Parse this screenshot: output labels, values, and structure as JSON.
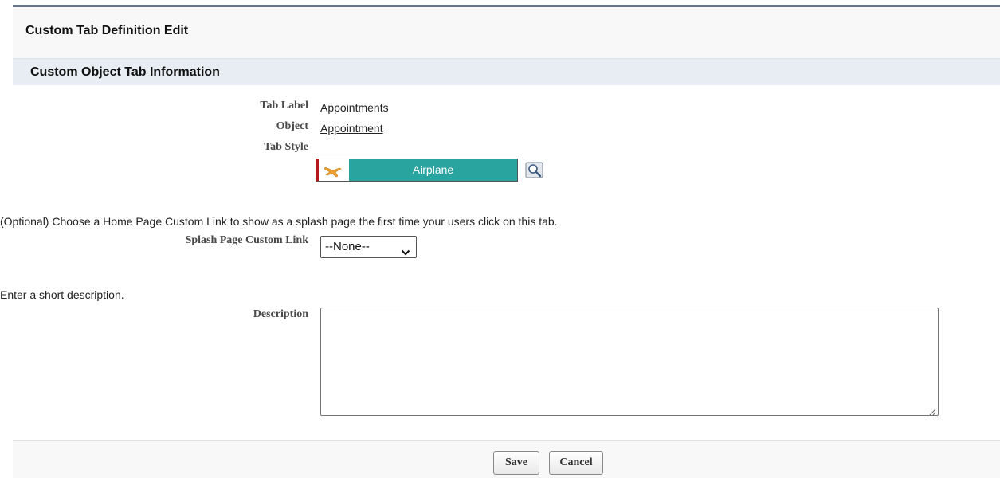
{
  "page": {
    "title": "Custom Tab Definition Edit"
  },
  "section": {
    "title": "Custom Object Tab Information"
  },
  "fields": {
    "tab_label": {
      "label": "Tab Label",
      "value": "Appointments"
    },
    "object": {
      "label": "Object",
      "value": "Appointment"
    },
    "tab_style": {
      "label": "Tab Style",
      "value": "Airplane",
      "swatch_color": "#2aa49f",
      "accent_color": "#b3181f",
      "icon": "airplane-icon"
    },
    "splash_help": "(Optional) Choose a Home Page Custom Link to show as a splash page the first time your users click on this tab.",
    "splash_link": {
      "label": "Splash Page Custom Link",
      "selected": "--None--"
    },
    "description_help": "Enter a short description.",
    "description": {
      "label": "Description",
      "value": ""
    }
  },
  "buttons": {
    "save": "Save",
    "cancel": "Cancel"
  }
}
